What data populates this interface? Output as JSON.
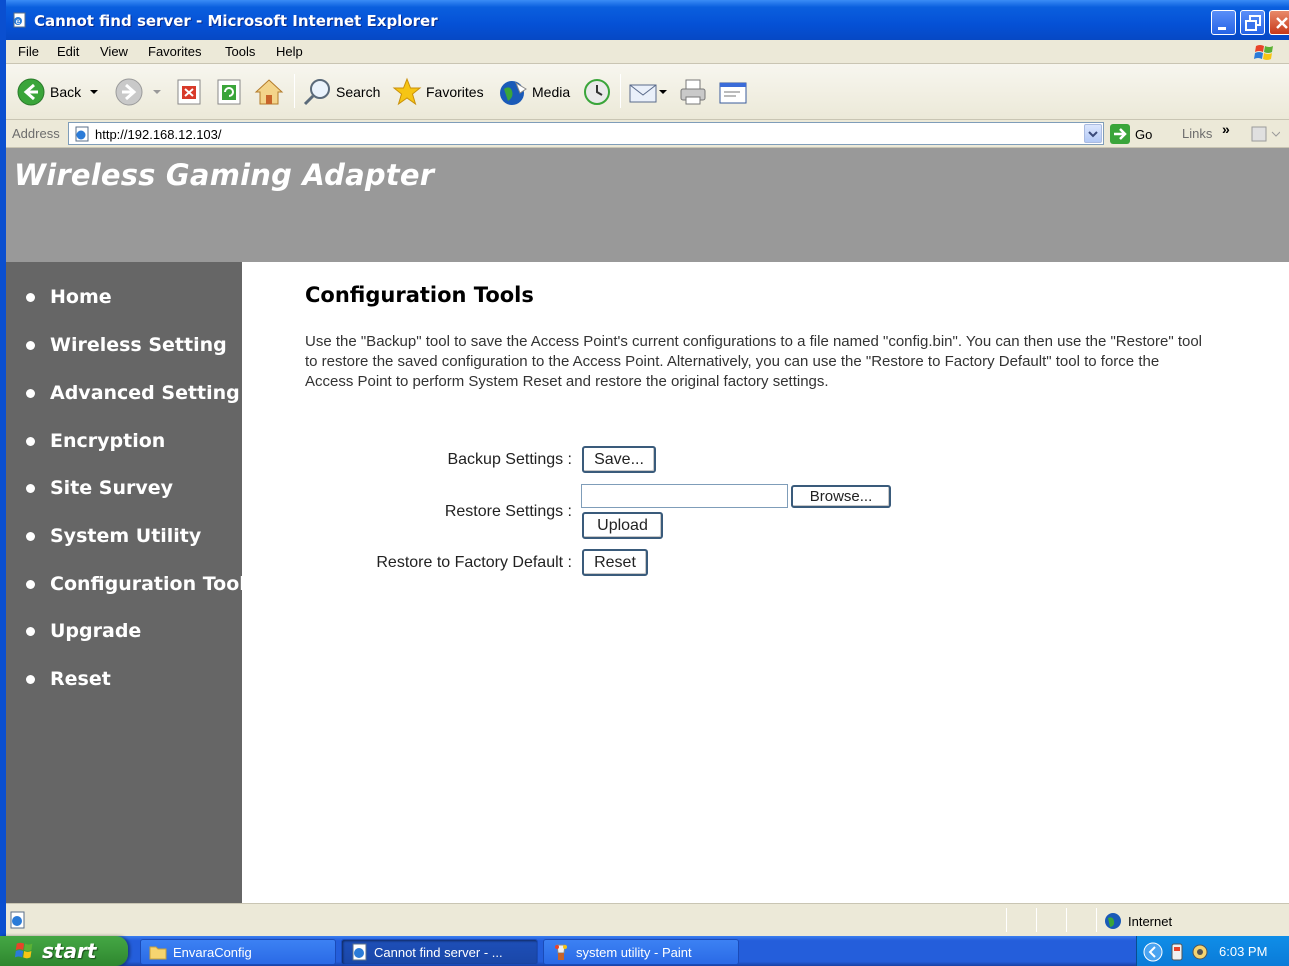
{
  "window": {
    "title": "Cannot find server - Microsoft Internet Explorer"
  },
  "menubar": {
    "items": [
      "File",
      "Edit",
      "View",
      "Favorites",
      "Tools",
      "Help"
    ]
  },
  "toolbar": {
    "back_label": "Back",
    "search_label": "Search",
    "favorites_label": "Favorites",
    "media_label": "Media"
  },
  "addressbar": {
    "label": "Address",
    "url": "http://192.168.12.103/",
    "go_label": "Go",
    "links_label": "Links",
    "links_chevron": "»"
  },
  "page": {
    "site_title": "Wireless Gaming Adapter",
    "nav": [
      {
        "label": "Home"
      },
      {
        "label": "Wireless Setting"
      },
      {
        "label": "Advanced Setting"
      },
      {
        "label": "Encryption"
      },
      {
        "label": "Site Survey"
      },
      {
        "label": "System Utility"
      },
      {
        "label": "Configuration Tool"
      },
      {
        "label": "Upgrade"
      },
      {
        "label": "Reset"
      }
    ],
    "title": "Configuration Tools",
    "description": "Use the \"Backup\" tool to save the Access Point's current configurations to a file named \"config.bin\". You can then use the \"Restore\" tool to restore the saved configuration to the Access Point. Alternatively, you can use the \"Restore to Factory Default\" tool to force the Access Point to perform System Reset and restore the original factory settings.",
    "backup_label": "Backup Settings :",
    "save_button": "Save...",
    "restore_label": "Restore Settings :",
    "restore_file_value": "",
    "browse_button": "Browse...",
    "upload_button": "Upload",
    "factory_label": "Restore to Factory Default :",
    "reset_button": "Reset"
  },
  "statusbar": {
    "zone_label": "Internet"
  },
  "taskbar": {
    "start_label": "start",
    "tasks": [
      {
        "label": "EnvaraConfig"
      },
      {
        "label": "Cannot find server - ..."
      },
      {
        "label": "system utility - Paint"
      }
    ],
    "clock": "6:03 PM"
  },
  "colors": {
    "header_bg": "#999999",
    "sidebar_bg": "#666666",
    "titlebar_blue": "#0551d6"
  }
}
